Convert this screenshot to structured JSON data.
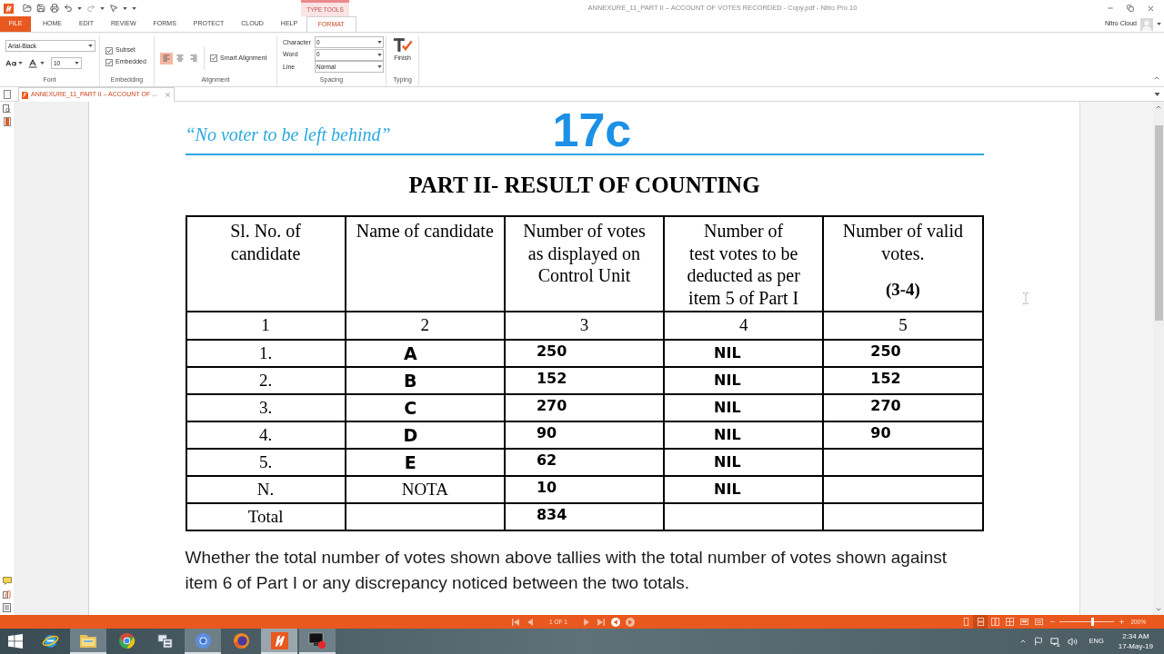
{
  "title_bar": {
    "context_tab": "TYPE TOOLS",
    "title": "ANNEXURE_11_PART II – ACCOUNT OF VOTES RECORDED - Copy.pdf - Nitro Pro 10"
  },
  "menu_tabs": [
    {
      "label": "FILE",
      "kind": "file",
      "selected": false
    },
    {
      "label": "HOME",
      "kind": "tab",
      "selected": false
    },
    {
      "label": "EDIT",
      "kind": "tab",
      "selected": false
    },
    {
      "label": "REVIEW",
      "kind": "tab",
      "selected": false
    },
    {
      "label": "FORMS",
      "kind": "tab",
      "selected": false
    },
    {
      "label": "PROTECT",
      "kind": "tab",
      "selected": false
    },
    {
      "label": "CLOUD",
      "kind": "tab",
      "selected": false
    },
    {
      "label": "HELP",
      "kind": "tab",
      "selected": false
    },
    {
      "label": "FORMAT",
      "kind": "tab",
      "selected": true
    }
  ],
  "account": {
    "label": "Nitro Cloud"
  },
  "ribbon": {
    "font": {
      "label": "Font",
      "family": "Arial-Black",
      "size": "10"
    },
    "embedding": {
      "label": "Embedding",
      "options": [
        {
          "label": "Subset",
          "checked": true
        },
        {
          "label": "Embedded",
          "checked": true
        }
      ]
    },
    "alignment": {
      "label": "Alignment",
      "buttons": [
        {
          "kind": "left",
          "selected": true
        },
        {
          "kind": "center",
          "selected": false
        },
        {
          "kind": "right",
          "selected": false
        }
      ],
      "smart_alignment": {
        "label": "Smart Alignment",
        "checked": true
      }
    },
    "spacing": {
      "label": "Spacing",
      "rows": [
        {
          "label": "Character",
          "value": "0"
        },
        {
          "label": "Word",
          "value": "0"
        },
        {
          "label": "Line",
          "value": "Normal"
        }
      ]
    },
    "typing": {
      "label": "Typing",
      "button": "Finish"
    }
  },
  "document_tab": {
    "title": "ANNEXURE_11_PART II – ACCOUNT OF ..."
  },
  "document": {
    "tagline": "“No voter to be left behind”",
    "form_code": "17c",
    "heading": "PART II- RESULT OF COUNTING",
    "table": {
      "columns": [
        {
          "lines": [
            "Sl. No. of",
            "candidate"
          ],
          "number": "1"
        },
        {
          "lines": [
            "Name of candidate"
          ],
          "number": "2"
        },
        {
          "lines": [
            "Number of votes",
            "as displayed on",
            "Control Unit"
          ],
          "number": "3"
        },
        {
          "lines": [
            "Number of",
            "test votes to be",
            "deducted as per",
            "item 5 of Part I"
          ],
          "number": "4"
        },
        {
          "lines": [
            "Number of valid",
            "votes."
          ],
          "note": "(3-4)",
          "number": "5"
        }
      ],
      "rows": [
        {
          "kind": "candidate",
          "sl_no": "1.",
          "name": "A",
          "votes_displayed": "250",
          "test_votes": "NIL",
          "valid_votes": "250"
        },
        {
          "kind": "candidate",
          "sl_no": "2.",
          "name": "B",
          "votes_displayed": "152",
          "test_votes": "NIL",
          "valid_votes": "152"
        },
        {
          "kind": "candidate",
          "sl_no": "3.",
          "name": "C",
          "votes_displayed": "270",
          "test_votes": "NIL",
          "valid_votes": "270"
        },
        {
          "kind": "candidate",
          "sl_no": "4.",
          "name": "D",
          "votes_displayed": "90",
          "test_votes": "NIL",
          "valid_votes": "90"
        },
        {
          "kind": "candidate",
          "sl_no": "5.",
          "name": "E",
          "votes_displayed": "62",
          "test_votes": "NIL"
        },
        {
          "kind": "nota",
          "sl_no": "N.",
          "name": "NOTA",
          "votes_displayed": "10",
          "test_votes": "NIL"
        },
        {
          "kind": "total",
          "sl_no": "Total",
          "votes_displayed": "834"
        }
      ]
    },
    "paragraph": "Whether the total number of votes shown above tallies with the total number of votes shown against item 6 of Part I or any discrepancy noticed between the two totals."
  },
  "status_bar": {
    "navigation": [
      {
        "kind": "first",
        "disabled": true
      },
      {
        "kind": "previous",
        "disabled": true
      },
      {
        "kind": "next",
        "disabled": true
      },
      {
        "kind": "last",
        "disabled": true
      },
      {
        "kind": "back",
        "disabled": false
      },
      {
        "kind": "forward",
        "disabled": true
      }
    ],
    "page": "1 OF 1",
    "view_modes": [
      {
        "kind": "single",
        "selected": false
      },
      {
        "kind": "continuous",
        "selected": true
      },
      {
        "kind": "facing",
        "selected": false
      },
      {
        "kind": "facing_continuous",
        "selected": false
      },
      {
        "kind": "full_screen",
        "selected": false
      },
      {
        "kind": "presentation",
        "selected": false
      }
    ],
    "zoom": {
      "level": 0.6,
      "label": "200%"
    }
  },
  "taskbar": {
    "apps": [
      {
        "kind": "ie",
        "open": false,
        "active": false
      },
      {
        "kind": "folder",
        "open": true,
        "active": false
      },
      {
        "kind": "chrome",
        "open": false,
        "active": false
      },
      {
        "kind": "network",
        "open": false,
        "active": false
      },
      {
        "kind": "chromium",
        "open": true,
        "active": false
      },
      {
        "kind": "firefox",
        "open": false,
        "active": false
      },
      {
        "kind": "nitro",
        "open": true,
        "active": true
      },
      {
        "kind": "recorder",
        "open": true,
        "active": false
      }
    ],
    "language": "ENG",
    "time": "2:34 AM",
    "date": "17-May-19"
  }
}
